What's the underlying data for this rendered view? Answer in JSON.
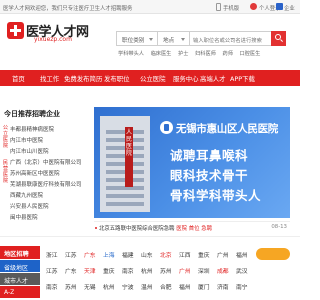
{
  "topbar": {
    "welcome": "医学人才网欢迎您，我们只专注医疗卫生人才招聘服务",
    "mobile_label": "手机版",
    "login_label": "个人登录",
    "employer_label": "企业"
  },
  "header": {
    "logo_text": "医学人才网",
    "logo_domain": "yixuezp.com",
    "search": {
      "category_label": "职位类别",
      "location_label": "地点",
      "placeholder": "输入职位名或公司名进行搜索"
    },
    "hotwords": [
      "学科带头人",
      "临床医生",
      "护士",
      "妇科医师",
      "药师",
      "口腔医生"
    ]
  },
  "nav": {
    "items": [
      "首页",
      "找工作",
      "免费发布简历",
      "发布职位",
      "公立医院",
      "服务中心",
      "高端人才",
      "APP下载"
    ]
  },
  "sidebar": {
    "title": "今日推荐招聘企业",
    "vertical_tags": [
      "公立医院",
      "民营医院"
    ],
    "items": [
      "丰都县精神病医院",
      "内江市中医院",
      "内江市山川医院",
      "广西（北京）中医院有限公司",
      "苏州高新区中医医院",
      "芜湖县联康医疗科技有限公司",
      "西藏九州医院",
      "兴安县人民医院",
      "闽中县医院"
    ]
  },
  "banner": {
    "sign_text": "人民医院",
    "hospital_name": "无锡市惠山区人民医院",
    "lines": [
      "诚聘耳鼻喉科",
      "眼科技术骨干",
      "骨科学科带头人"
    ]
  },
  "ticker": {
    "text": "北京五路联中医院综合医院急聘",
    "recommend_label": "医院 首位",
    "hire_label": "急聘",
    "date": "08-13"
  },
  "region": {
    "head": "地区招聘",
    "subs": [
      "省级地区",
      "城市人才",
      "A-Z"
    ],
    "row1": [
      "浙江",
      "江苏",
      "广东",
      "上海",
      "福建",
      "山东",
      "北京",
      "江西",
      "重庆",
      "广州",
      "福州"
    ],
    "row2": [
      "江苏",
      "广东",
      "天津",
      "重庆",
      "南京",
      "杭州",
      "苏州",
      "广州",
      "深圳",
      "成都",
      "武汉"
    ],
    "row3": [
      "南京",
      "苏州",
      "无锡",
      "杭州",
      "宁波",
      "温州",
      "合肥",
      "福州",
      "厦门",
      "济南",
      "南宁"
    ]
  }
}
